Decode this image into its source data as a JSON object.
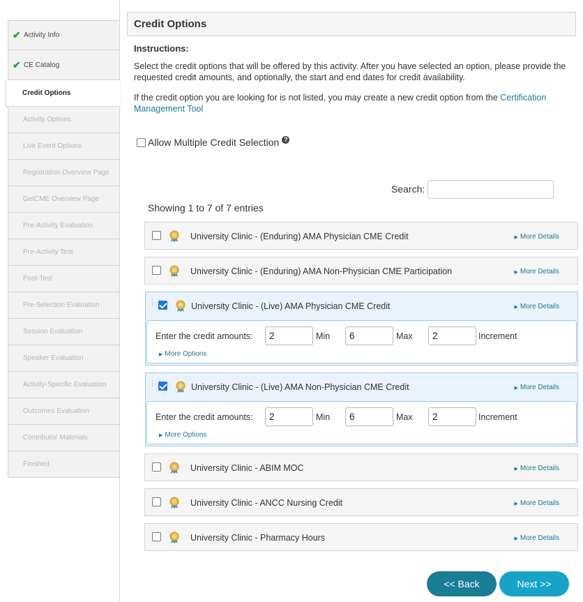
{
  "sidebar": {
    "items": [
      {
        "label": "Activity Info",
        "state": "done"
      },
      {
        "label": "CE Catalog",
        "state": "done"
      },
      {
        "label": "Credit Options",
        "state": "active"
      },
      {
        "label": "Activity Options",
        "state": "disabled"
      },
      {
        "label": "Live Event Options",
        "state": "disabled"
      },
      {
        "label": "Registration Overview Page",
        "state": "disabled"
      },
      {
        "label": "GetCME Overview Page",
        "state": "disabled"
      },
      {
        "label": "Pre-Activity Evaluation",
        "state": "disabled"
      },
      {
        "label": "Pre-Activity Test",
        "state": "disabled"
      },
      {
        "label": "Post-Test",
        "state": "disabled"
      },
      {
        "label": "Pre-Selection Evaluation",
        "state": "disabled"
      },
      {
        "label": "Session Evaluation",
        "state": "disabled"
      },
      {
        "label": "Speaker Evaluation",
        "state": "disabled"
      },
      {
        "label": "Activity-Specific Evaluation",
        "state": "disabled"
      },
      {
        "label": "Outcomes Evaluation",
        "state": "disabled"
      },
      {
        "label": "Contributor Materials",
        "state": "disabled"
      },
      {
        "label": "Finished",
        "state": "disabled"
      }
    ]
  },
  "main": {
    "title": "Credit Options",
    "instructions_title": "Instructions:",
    "instructions_p1": "Select the credit options that will be offered by this activity. After you have selected an option, please provide the requested credit amounts, and optionally, the start and end dates for credit availability.",
    "instructions_p2_prefix": "If the credit option you are looking for is not listed, you may create a new credit option from the ",
    "instructions_p2_link": "Certification Management Tool",
    "allow_multiple_label": "Allow Multiple Credit Selection",
    "search_label": "Search:",
    "search_value": "",
    "showing_text": "Showing 1 to 7 of 7 entries",
    "more_details": "More Details",
    "more_options": "More Options",
    "enter_amounts_label": "Enter the credit amounts:",
    "min_label": "Min",
    "max_label": "Max",
    "increment_label": "Increment",
    "credits": [
      {
        "title": "University Clinic - (Enduring) AMA Physician CME Credit",
        "checked": false
      },
      {
        "title": "University Clinic - (Enduring) AMA Non-Physician CME Participation",
        "checked": false
      },
      {
        "title": "University Clinic - (Live) AMA Physician CME Credit",
        "checked": true,
        "amount": "2",
        "min": "6",
        "max": "2"
      },
      {
        "title": "University Clinic - (Live) AMA Non-Physician CME Credit",
        "checked": true,
        "amount": "2",
        "min": "6",
        "max": "2"
      },
      {
        "title": "University Clinic - ABIM MOC",
        "checked": false
      },
      {
        "title": "University Clinic - ANCC Nursing Credit",
        "checked": false
      },
      {
        "title": "University Clinic - Pharmacy Hours",
        "checked": false
      }
    ],
    "back_label": "<< Back",
    "next_label": "Next >>"
  },
  "colors": {
    "link": "#17799a",
    "back_button": "#1a7d96",
    "next_button": "#16a3c8",
    "check": "#2e9e2e"
  }
}
